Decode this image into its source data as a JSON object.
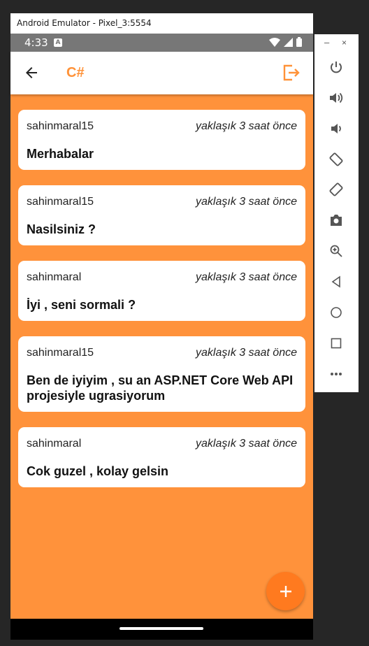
{
  "window": {
    "title": "Android Emulator - Pixel_3:5554"
  },
  "status_bar": {
    "time": "4:33",
    "notification_letter": "A"
  },
  "app_bar": {
    "title": "C#"
  },
  "messages": [
    {
      "user": "sahinmaral15",
      "time": "yaklaşık 3 saat önce",
      "text": "Merhabalar"
    },
    {
      "user": "sahinmaral15",
      "time": "yaklaşık 3 saat önce",
      "text": "Nasilsiniz ?"
    },
    {
      "user": "sahinmaral",
      "time": "yaklaşık 3 saat önce",
      "text": "İyi , seni sormali ?"
    },
    {
      "user": "sahinmaral15",
      "time": "yaklaşık 3 saat önce",
      "text": "Ben de iyiyim , su an ASP.NET Core Web API projesiyle ugrasiyorum"
    },
    {
      "user": "sahinmaral",
      "time": "yaklaşık 3 saat önce",
      "text": "Cok guzel , kolay gelsin"
    }
  ],
  "side_panel": {
    "minimize": "–",
    "close": "×",
    "buttons": [
      "power-icon",
      "volume-up-icon",
      "volume-down-icon",
      "rotate-left-icon",
      "rotate-right-icon",
      "camera-icon",
      "zoom-icon",
      "back-icon",
      "home-icon",
      "overview-icon",
      "more-icon"
    ]
  },
  "colors": {
    "accent": "#ff9238",
    "background": "#ff923b",
    "fab": "#ff7a1f"
  }
}
